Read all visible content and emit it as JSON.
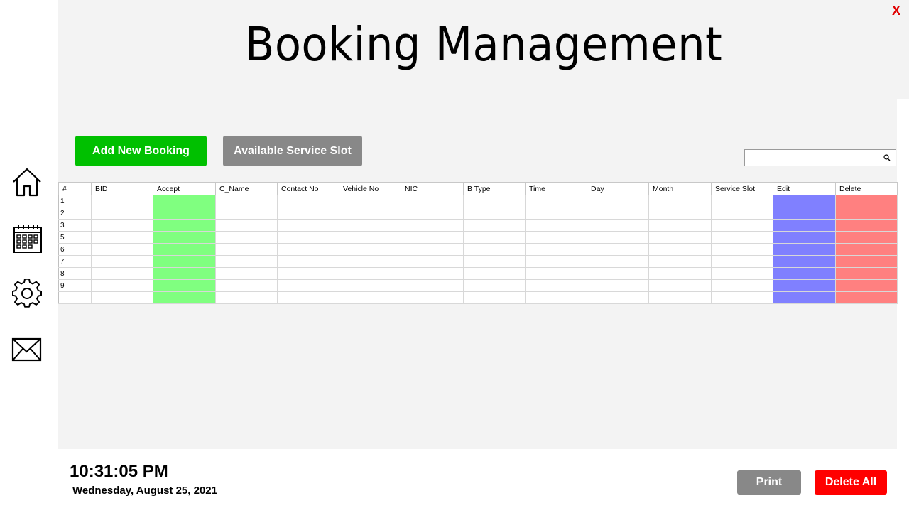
{
  "header": {
    "title": "Booking Management",
    "close_label": "X"
  },
  "sidebar": {
    "items": [
      "home-icon",
      "calendar-icon",
      "gear-icon",
      "mail-icon"
    ]
  },
  "toolbar": {
    "add_label": "Add New Booking",
    "slot_label": "Available Service Slot",
    "search_value": ""
  },
  "table": {
    "columns": [
      "#",
      "BID",
      "Accept",
      "C_Name",
      "Contact No",
      "Vehicle No",
      "NIC",
      "B Type",
      "Time",
      "Day",
      "Month",
      "Service Slot",
      "Edit",
      "Delete"
    ],
    "row_numbers": [
      "1",
      "2",
      "3",
      "5",
      "6",
      "7",
      "8",
      "9",
      ""
    ]
  },
  "footer": {
    "time": "10:31:05 PM",
    "date": "Wednesday, August 25, 2021",
    "print_label": "Print",
    "delete_all_label": "Delete All"
  },
  "colors": {
    "add": "#00c000",
    "neutral": "#888888",
    "danger": "#ff0000",
    "accept_cell": "#80ff80",
    "edit_cell": "#8080ff",
    "delete_cell": "#ff8080"
  }
}
